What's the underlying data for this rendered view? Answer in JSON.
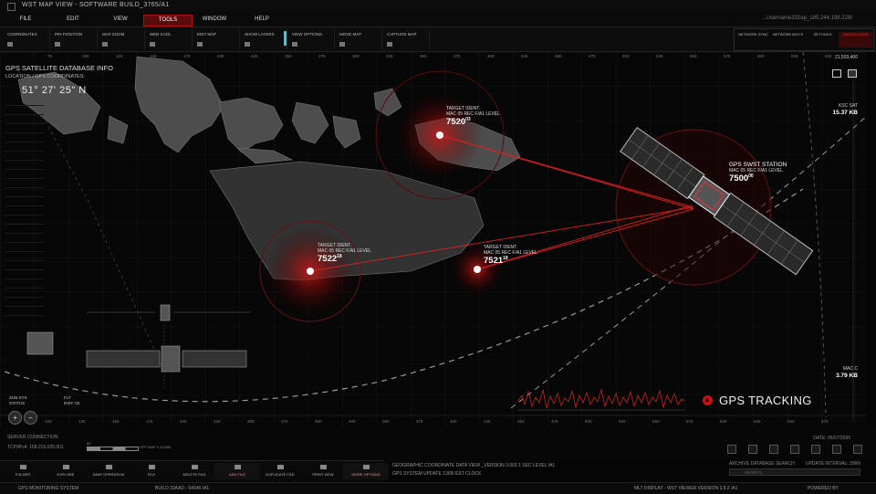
{
  "window": {
    "title": "WST MAP VIEW - SOFTWARE BUILD_3765/A1"
  },
  "menu": {
    "items": [
      "FILE",
      "EDIT",
      "VIEW",
      "TOOLS",
      "WINDOW",
      "HELP"
    ],
    "active": "TOOLS",
    "user_ip": "...Username332ap_185.244.198.228/"
  },
  "toolbar": {
    "items": [
      "COORDINATES",
      "PIN POSITION",
      "MAP ZOOM",
      "WEB GADL",
      "EDIT MAP",
      "SHOW LAYERS",
      "VIEW OPTIONS",
      "MOVE MAP",
      "CAPTURE MAP"
    ]
  },
  "right_toolbar": {
    "network": "NETWORK\nSYNC",
    "network2": "NETWORK\nINSYS",
    "settings": "SETTINGS",
    "switch": "SWITCH\nUSER"
  },
  "header": {
    "title": "GPS SATELLITE DATABASE INFO",
    "subtitle": "LOCATION / GPS COORDINATES:",
    "coords": "51° 27' 25\" N"
  },
  "targets": [
    {
      "label": "TARGET IDENT.",
      "sub": "MAC 05 REC F/A1 LEVEL",
      "id": "7520",
      "sup": "03"
    },
    {
      "label": "TARGET IDENT.",
      "sub": "MAC 05 REC F/A1 LEVEL",
      "id": "7522",
      "sup": "18"
    },
    {
      "label": "TARGET IDENT.",
      "sub": "MAC 05 REC F/A1 LEVEL",
      "id": "7521",
      "sup": "18"
    }
  ],
  "station": {
    "label": "GPS SWST STATION",
    "sub": "MAC 05 REC F/A1 LEVEL",
    "id": "7500",
    "sup": "00"
  },
  "right_stats": {
    "top_value": "21,503,400",
    "ksc_label": "KSC SAT",
    "ksc_value": "15.37 KB",
    "mac_label": "MAC C",
    "mac_value": "3.79 KB"
  },
  "gps_tracking": "GPS TRACKING",
  "subsys": {
    "line1": "SUB SYS",
    "line2": "STATUS",
    "flt": "FLT",
    "flt_val": "INST. 02"
  },
  "x_ticks": [
    "100",
    "125",
    "150",
    "175",
    "200",
    "225",
    "250",
    "275",
    "300",
    "325",
    "350",
    "375",
    "400",
    "425",
    "450",
    "475",
    "500",
    "525",
    "550",
    "575",
    "600",
    "625",
    "650",
    "675"
  ],
  "top_ticks": [
    "75",
    "100",
    "125",
    "150",
    "175",
    "200",
    "225",
    "250",
    "275",
    "300",
    "325",
    "350",
    "375",
    "400",
    "425",
    "450",
    "475",
    "500",
    "525",
    "550",
    "575",
    "600",
    "625",
    "650"
  ],
  "status": {
    "server": "SERVER CONNECTION",
    "ip": "TCP/IPv4: 168.215.035.001",
    "date": "DATE: 05/07/2035",
    "scale_left": "50",
    "scale_right": "OFF MAP 5 1/1000"
  },
  "taskbar": {
    "items": [
      "FOLDER",
      "EXPLORE",
      "SAVE OPERATION",
      "FILE",
      "DELETE FILE",
      "ADD FILE",
      "DUPLICATE FILE",
      "PRINT VIEW",
      "MORE OPTIONS"
    ],
    "highlighted": [
      "ADD FILE",
      "MORE OPTIONS"
    ]
  },
  "messages": {
    "line1": "GEOGRAPHIC COORDINATE DATA VIEW _VERSION 3.002.1 SEC LEVEL /A1",
    "line2": "GPS SYSTEM UPDATE 13/05 EST CLOCK"
  },
  "search": {
    "label": "ARCHIVE DATABASE SEARCH",
    "update": "UPDATE INTERVAL: 2MIN",
    "placeholder": "SEARCH..."
  },
  "footer": {
    "left": "GPS MONITORING SYSTEM",
    "build": "BUILD 33AAD - 54546 /A1",
    "display": "MLT DISPLAY - WST VIEWER VERSION 3.5.2 /A1",
    "powered": "POWERED BY"
  },
  "colors": {
    "accent_red": "#c21414",
    "accent_cyan": "#3cc8e0",
    "bg": "#050505"
  }
}
